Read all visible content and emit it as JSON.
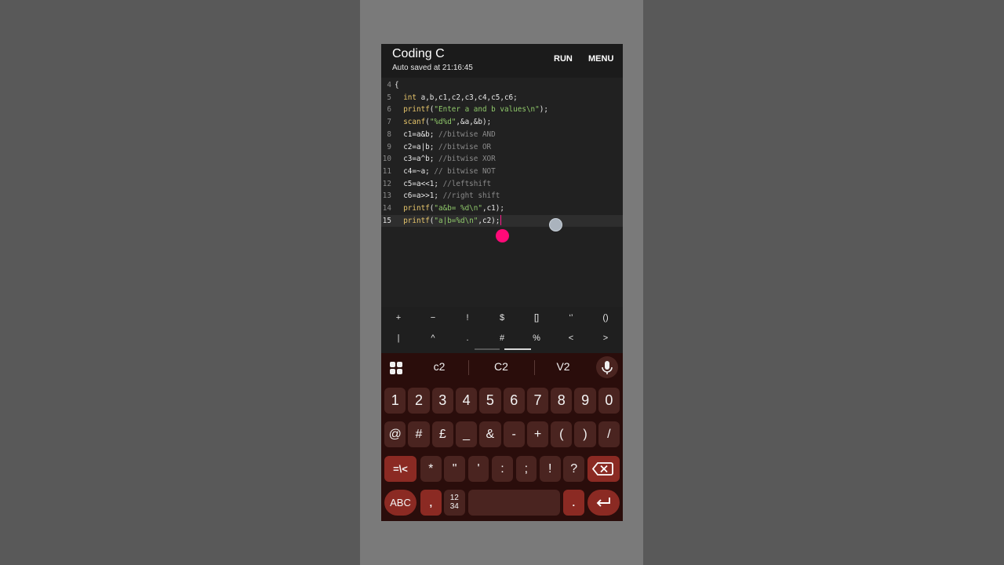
{
  "app": {
    "title": "Coding C",
    "subtitle": "Auto saved at 21:16:45",
    "run_label": "RUN",
    "menu_label": "MENU"
  },
  "code_lines": [
    {
      "n": "4",
      "text": "{"
    },
    {
      "n": "5",
      "text": "  int a,b,c1,c2,c3,c4,c5,c6;"
    },
    {
      "n": "6",
      "text": "  printf(\"Enter a and b values\\n\");"
    },
    {
      "n": "7",
      "text": "  scanf(\"%d%d\",&a,&b);"
    },
    {
      "n": "8",
      "text": "  c1=a&b; //bitwise AND"
    },
    {
      "n": "9",
      "text": "  c2=a|b; //bitwise OR"
    },
    {
      "n": "10",
      "text": "  c3=a^b; //bitwise XOR"
    },
    {
      "n": "11",
      "text": "  c4=~a; // bitwise NOT"
    },
    {
      "n": "12",
      "text": "  c5=a<<1; //leftshift"
    },
    {
      "n": "13",
      "text": "  c6=a>>1; //right shift"
    },
    {
      "n": "14",
      "text": "  printf(\"a&b= %d\\n\",c1);"
    },
    {
      "n": "15",
      "text": "  printf(\"a|b=%d\\n\",c2);"
    }
  ],
  "symbols_row1": [
    "+",
    "−",
    "!",
    "$",
    "[]",
    "‘’",
    "()"
  ],
  "symbols_row2": [
    "|",
    "^",
    ".",
    "#",
    "%",
    "<",
    ">"
  ],
  "suggestions": [
    "c2",
    "C2",
    "V2"
  ],
  "keyboard": {
    "row1": [
      "1",
      "2",
      "3",
      "4",
      "5",
      "6",
      "7",
      "8",
      "9",
      "0"
    ],
    "row2": [
      "@",
      "#",
      "£",
      "_",
      "&",
      "-",
      "+",
      "(",
      ")",
      "/"
    ],
    "row3_mode": "=\\<",
    "row3": [
      "*",
      "\"",
      "'",
      ":",
      ";",
      "!",
      "?"
    ],
    "abc": "ABC",
    "comma": ",",
    "numpad": "12\n34",
    "period": "."
  },
  "icons": {
    "grid": "apps-grid-icon",
    "mic": "microphone-icon",
    "backspace": "backspace-icon",
    "enter": "enter-icon"
  },
  "colors": {
    "keyword": "#e6c56b",
    "string": "#8fc86a",
    "comment": "#8a8a8a",
    "keyboard_bg": "#2a0d0b",
    "key_bg": "#4a2420",
    "func_key_bg": "#8b2a23",
    "cursor_handle": "#ff0a78"
  }
}
